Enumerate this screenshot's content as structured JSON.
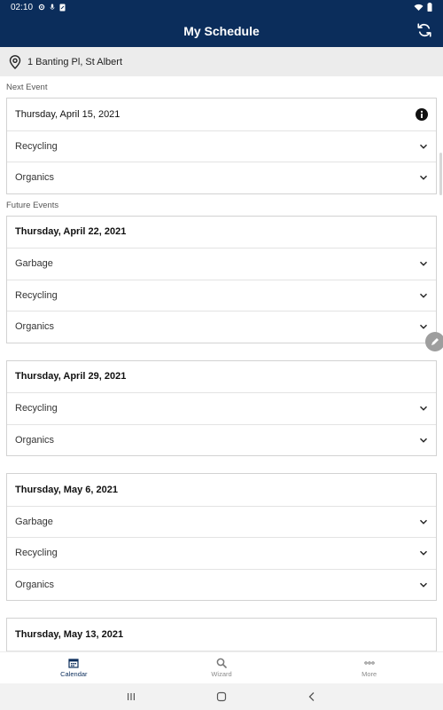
{
  "status_bar": {
    "time": "02:10"
  },
  "header": {
    "title": "My Schedule"
  },
  "address": {
    "text": "1 Banting Pl, St Albert"
  },
  "sections": {
    "next": "Next Event",
    "future": "Future Events"
  },
  "next_event": {
    "date": "Thursday, April 15, 2021",
    "items": [
      "Recycling",
      "Organics"
    ]
  },
  "future_events": [
    {
      "date": "Thursday, April 22, 2021",
      "items": [
        "Garbage",
        "Recycling",
        "Organics"
      ]
    },
    {
      "date": "Thursday, April 29, 2021",
      "items": [
        "Recycling",
        "Organics"
      ]
    },
    {
      "date": "Thursday, May 6, 2021",
      "items": [
        "Garbage",
        "Recycling",
        "Organics"
      ]
    },
    {
      "date": "Thursday, May 13, 2021",
      "items": []
    }
  ],
  "bottom_nav": {
    "calendar": "Calendar",
    "wizard": "Wizard",
    "more": "More"
  },
  "colors": {
    "brand": "#0b2d5b",
    "background": "#ffffff",
    "address_bar": "#ececec"
  }
}
